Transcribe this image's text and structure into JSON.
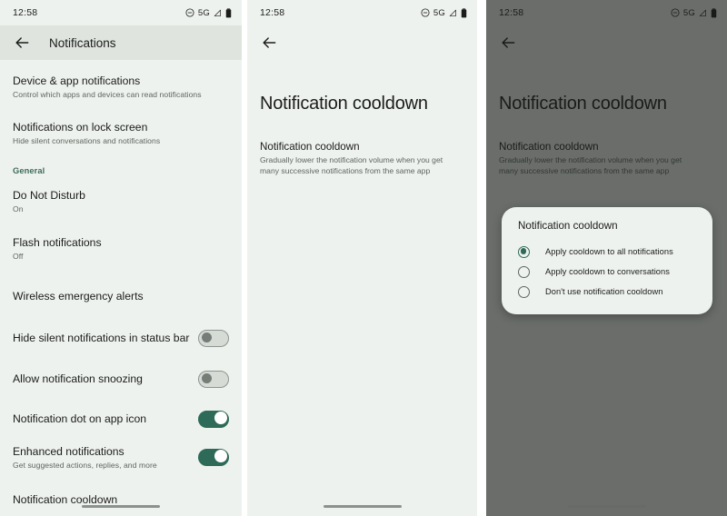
{
  "status_bar": {
    "time": "12:58",
    "dnd_icon": "do-not-disturb-icon",
    "network": "5G",
    "signal_icon": "signal-strength-icon",
    "battery_icon": "battery-full-icon"
  },
  "colors": {
    "accent_green": "#2e6a58",
    "section_label": "#3d6b5b",
    "panel_background": "#eef2ee",
    "app_bar_background": "#dfe4df",
    "scrim": "rgba(25,28,25,0.62)",
    "toggle_off_track": "#d6dbd6",
    "toggle_off_knob": "#767d78",
    "primary_text": "#1b1c1b",
    "secondary_text": "#5f6560"
  },
  "panel1": {
    "app_bar": {
      "back_icon": "back-arrow-icon",
      "title": "Notifications"
    },
    "rows": [
      {
        "title": "Device & app notifications",
        "subtitle": "Control which apps and devices can read notifications",
        "control": "none"
      },
      {
        "title": "Notifications on lock screen",
        "subtitle": "Hide silent conversations and notifications",
        "control": "none"
      },
      {
        "title": "Do Not Disturb",
        "subtitle": "On",
        "control": "none"
      },
      {
        "title": "Flash notifications",
        "subtitle": "Off",
        "control": "none"
      },
      {
        "title": "Wireless emergency alerts",
        "subtitle": "",
        "control": "none"
      },
      {
        "title": "Hide silent notifications in status bar",
        "subtitle": "",
        "control": "toggle",
        "toggle_state": "off"
      },
      {
        "title": "Allow notification snoozing",
        "subtitle": "",
        "control": "toggle",
        "toggle_state": "off"
      },
      {
        "title": "Notification dot on app icon",
        "subtitle": "",
        "control": "toggle",
        "toggle_state": "on"
      },
      {
        "title": "Enhanced notifications",
        "subtitle": "Get suggested actions, replies, and more",
        "control": "toggle",
        "toggle_state": "on"
      },
      {
        "title": "Notification cooldown",
        "subtitle": "",
        "control": "none"
      }
    ],
    "section_label": "General"
  },
  "panel2": {
    "app_bar": {
      "back_icon": "back-arrow-icon"
    },
    "heading": "Notification cooldown",
    "item_title": "Notification cooldown",
    "item_body": "Gradually lower the notification volume when you get many successive notifications from the same app"
  },
  "panel3": {
    "app_bar": {
      "back_icon": "back-arrow-icon"
    },
    "heading": "Notification cooldown",
    "item_title": "Notification cooldown",
    "item_body": "Gradually lower the notification volume when you get many successive notifications from the same app",
    "dialog": {
      "title": "Notification cooldown",
      "options": [
        {
          "label": "Apply cooldown to all notifications",
          "selected": true
        },
        {
          "label": "Apply cooldown to conversations",
          "selected": false
        },
        {
          "label": "Don't use notification cooldown",
          "selected": false
        }
      ]
    }
  }
}
